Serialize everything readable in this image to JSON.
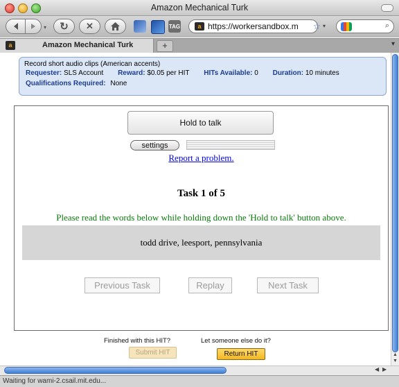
{
  "window": {
    "title": "Amazon Mechanical Turk"
  },
  "toolbar": {
    "url": "https://workersandbox.m",
    "icons": [
      "back-icon",
      "forward-icon",
      "reload-icon",
      "stop-icon",
      "home-icon",
      "bookmark-icon",
      "tag-icon",
      "site-favicon",
      "star-icon",
      "google-icon",
      "search-icon"
    ],
    "tag_label": "TAG"
  },
  "tab": {
    "label": "Amazon Mechanical Turk",
    "new_tab": "+"
  },
  "hit_info": {
    "title": "Record short audio clips (American accents)",
    "requester_label": "Requester:",
    "requester_value": "SLS Account",
    "reward_label": "Reward:",
    "reward_value": "$0.05 per HIT",
    "available_label": "HITs Available:",
    "available_value": "0",
    "duration_label": "Duration:",
    "duration_value": "10 minutes",
    "qual_label": "Qualifications Required:",
    "qual_value": "None"
  },
  "task": {
    "hold_label": "Hold to talk",
    "settings_label": "settings",
    "report_link": "Report a problem.",
    "task_title": "Task 1 of 5",
    "instruction": "Please read the words below while holding down the 'Hold to talk' button above.",
    "phrase": "todd drive, leesport, pennsylvania",
    "prev_label": "Previous Task",
    "replay_label": "Replay",
    "next_label": "Next Task"
  },
  "footer": {
    "finished_text": "Finished with this HIT?",
    "others_text": "Let someone else do it?",
    "submit_label": "Submit HIT",
    "return_label": "Return HIT"
  },
  "status": {
    "text": "Waiting for wami-2.csail.mit.edu..."
  },
  "colors": {
    "accent_blue": "#1d3d8f",
    "instruction_green": "#0a7a0a",
    "return_button": "#f3b722",
    "info_bg": "#dbe7f7"
  }
}
